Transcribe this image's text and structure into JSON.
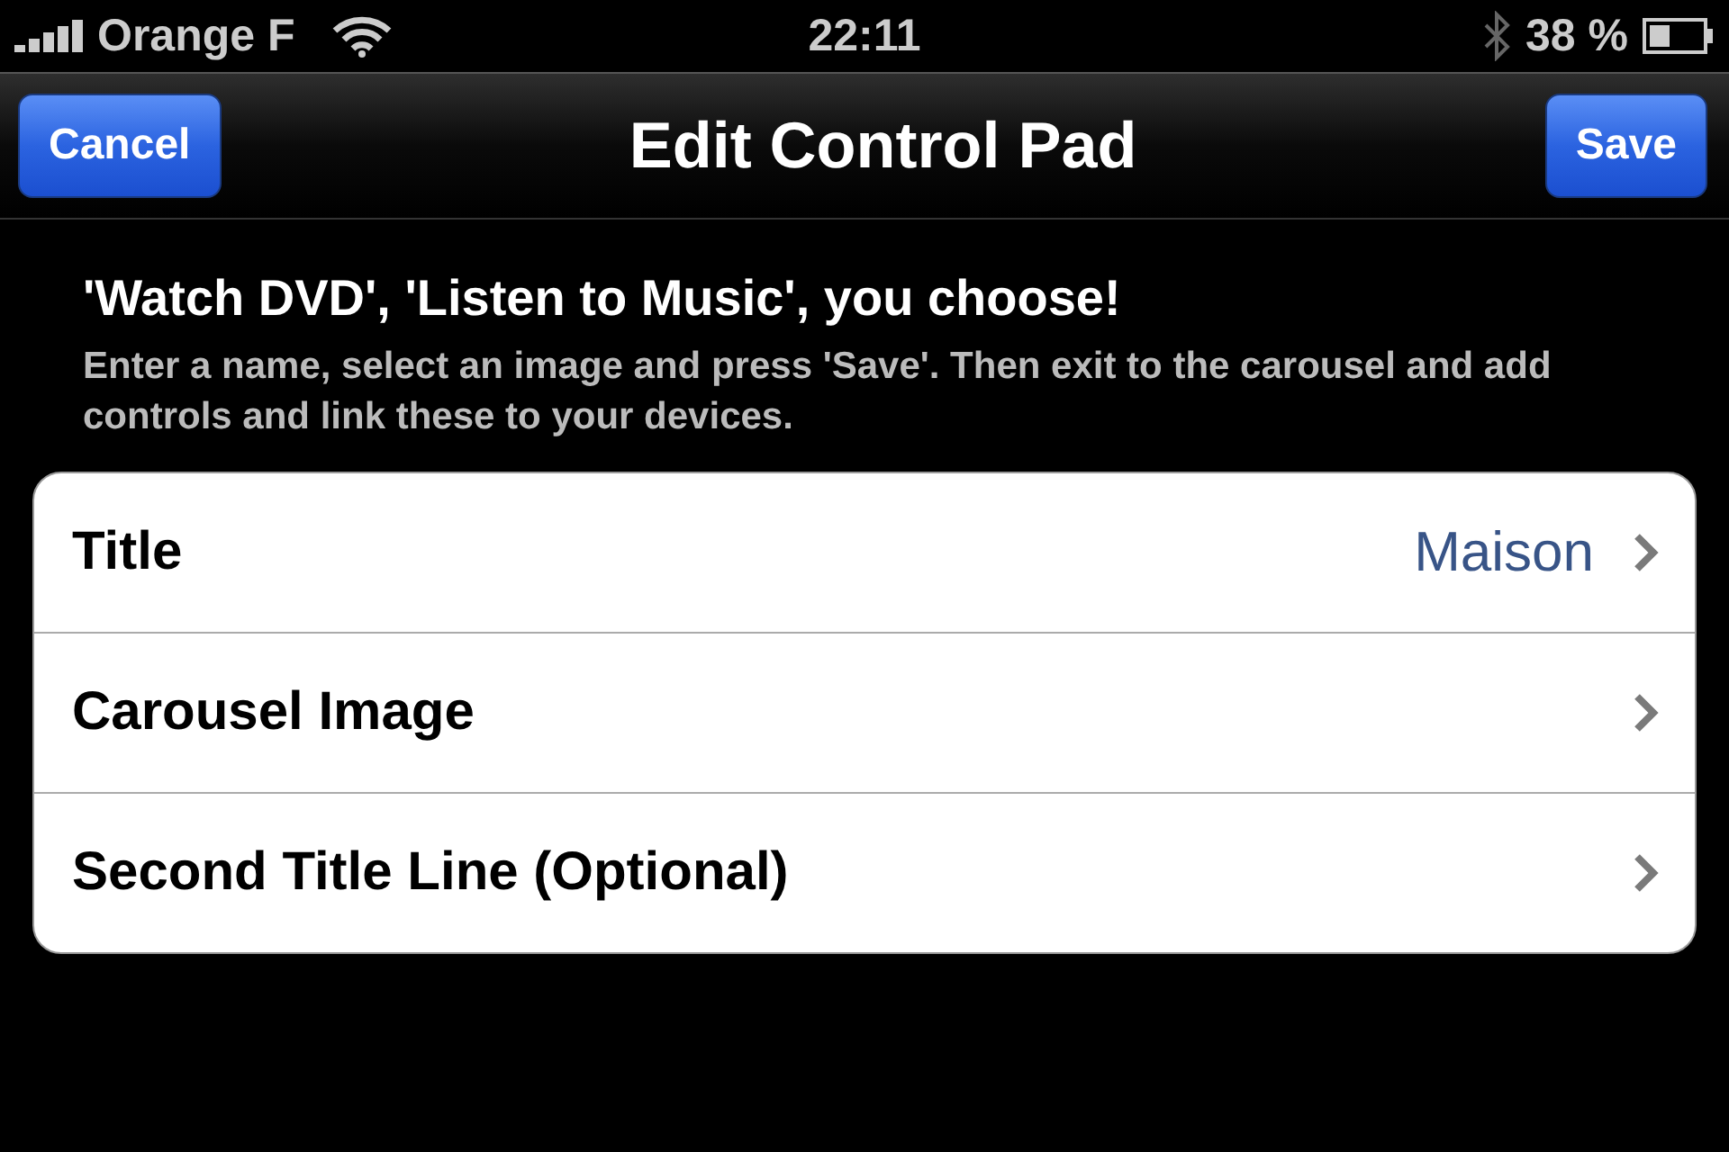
{
  "status_bar": {
    "carrier": "Orange F",
    "time": "22:11",
    "battery": "38 %"
  },
  "nav_bar": {
    "title": "Edit Control Pad",
    "left_button": "Cancel",
    "right_button": "Save"
  },
  "header": {
    "title": "'Watch DVD', 'Listen to Music', you choose!",
    "description": "Enter a name, select an image and press 'Save'. Then exit to the carousel and add controls and link these to your devices."
  },
  "rows": [
    {
      "label": "Title",
      "value": "Maison"
    },
    {
      "label": "Carousel Image"
    },
    {
      "label": "Second Title Line (Optional)"
    }
  ]
}
